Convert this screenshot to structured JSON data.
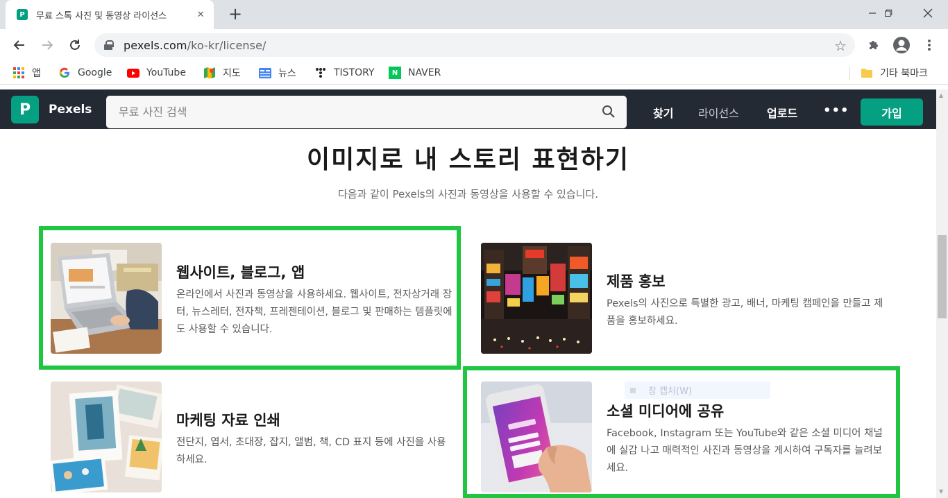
{
  "browser": {
    "tab_title": "무료 스톡 사진 및 동영상 라이선스",
    "url_host": "pexels.com",
    "url_path": "/ko-kr/license/",
    "bookmarks": [
      {
        "label": "앱",
        "icon": "apps-grid-icon"
      },
      {
        "label": "Google",
        "icon": "google-icon"
      },
      {
        "label": "YouTube",
        "icon": "youtube-icon"
      },
      {
        "label": "지도",
        "icon": "maps-icon"
      },
      {
        "label": "뉴스",
        "icon": "news-icon"
      },
      {
        "label": "TISTORY",
        "icon": "tistory-icon"
      },
      {
        "label": "NAVER",
        "icon": "naver-icon"
      }
    ],
    "other_bookmarks": "기타 북마크"
  },
  "pexels_nav": {
    "brand": "Pexels",
    "search_placeholder": "무료 사진 검색",
    "links": [
      "찾기",
      "라이선스",
      "업로드"
    ],
    "more": "•••",
    "join": "가입"
  },
  "hero": {
    "title": "이미지로 내 스토리 표현하기",
    "subtitle": "다음과 같이 Pexels의 사진과 동영상을 사용할 수 있습니다."
  },
  "cards": [
    {
      "title": "웹사이트, 블로그, 앱",
      "desc": "온라인에서 사진과 동영상을 사용하세요. 웹사이트, 전자상거래 장터, 뉴스레터, 전자책, 프레젠테이션, 블로그 및 판매하는 템플릿에도 사용할 수 있습니다."
    },
    {
      "title": "제품 홍보",
      "desc": "Pexels의 사진으로 특별한 광고, 배너, 마케팅 캠페인을 만들고 제품을 홍보하세요."
    },
    {
      "title": "마케팅 자료 인쇄",
      "desc": "전단지, 엽서, 초대장, 잡지, 앨범, 책, CD 표지 등에 사진을 사용하세요."
    },
    {
      "title": "소셜 미디어에 공유",
      "desc": "Facebook, Instagram 또는 YouTube와 같은 소셜 미디어 채널에 실감 나고 매력적인 사진과 동영상을 게시하여 구독자를 늘려보세요."
    }
  ],
  "overlay_ghost": "창 캡처(W)",
  "colors": {
    "pexels_green": "#05a081",
    "nav_bg": "#232a34",
    "highlight": "#1ec642"
  }
}
